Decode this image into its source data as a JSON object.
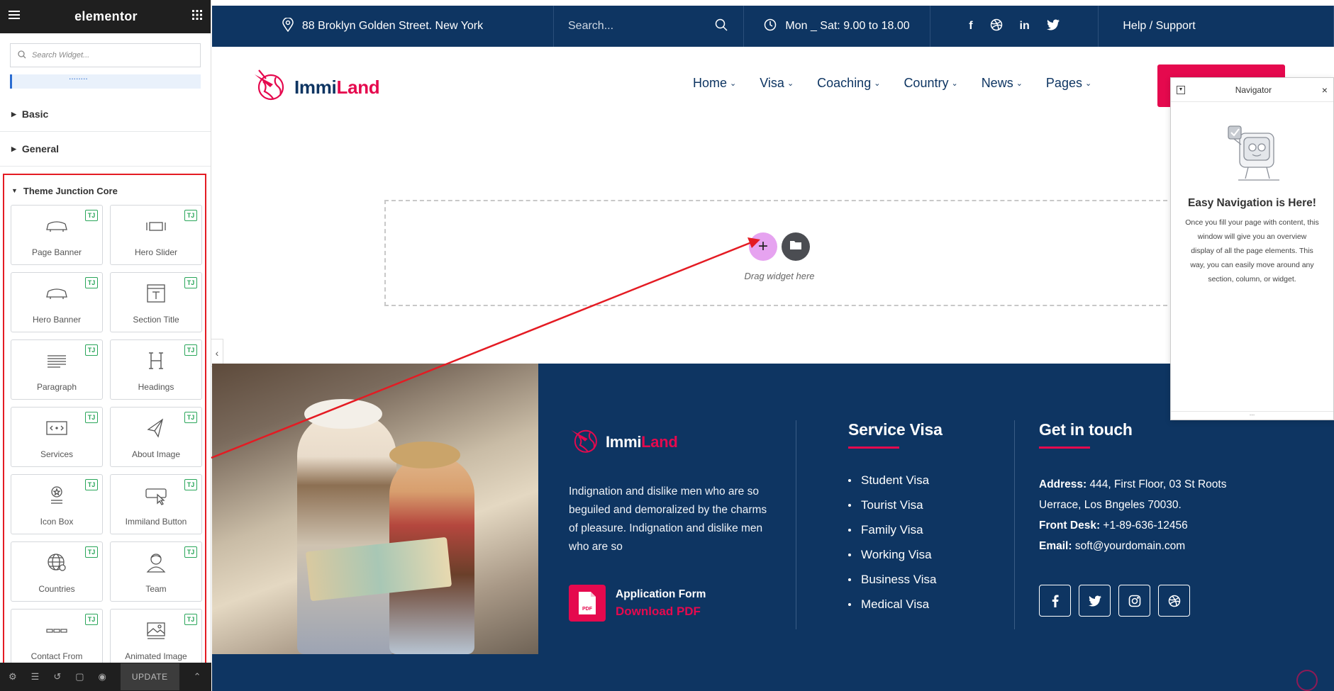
{
  "panel": {
    "logo": "elementor",
    "search_placeholder": "Search Widget...",
    "categories": [
      {
        "label": "Basic"
      },
      {
        "label": "General"
      }
    ],
    "theme_category": "Theme Junction Core",
    "badge": "TJ",
    "widgets": [
      {
        "label": "Page Banner",
        "icon": "sofa-icon"
      },
      {
        "label": "Hero Slider",
        "icon": "slider-icon"
      },
      {
        "label": "Hero Banner",
        "icon": "sofa-icon"
      },
      {
        "label": "Section Title",
        "icon": "text-icon"
      },
      {
        "label": "Paragraph",
        "icon": "paragraph-icon"
      },
      {
        "label": "Headings",
        "icon": "heading-icon"
      },
      {
        "label": "Services",
        "icon": "services-icon"
      },
      {
        "label": "About Image",
        "icon": "send-icon"
      },
      {
        "label": "Icon Box",
        "icon": "star-badge-icon"
      },
      {
        "label": "Immiland Button",
        "icon": "pointer-button-icon"
      },
      {
        "label": "Countries",
        "icon": "globe-icon"
      },
      {
        "label": "Team",
        "icon": "person-icon"
      },
      {
        "label": "Contact From",
        "icon": "form-icon"
      },
      {
        "label": "Animated Image",
        "icon": "image-icon"
      }
    ],
    "update_label": "UPDATE"
  },
  "topbar": {
    "address": "88 Broklyn Golden Street. New York",
    "search_placeholder": "Search...",
    "hours": "Mon _ Sat: 9.00 to 18.00",
    "help": "Help / Support"
  },
  "site": {
    "brand_part1": "Immi",
    "brand_part2": "Land",
    "nav": [
      "Home",
      "Visa",
      "Coaching",
      "Country",
      "News",
      "Pages"
    ]
  },
  "dropzone": {
    "text": "Drag widget here"
  },
  "footer": {
    "about": "Indignation and dislike men who are so beguiled and demoralized by the charms of pleasure. Indignation and dislike men who are so",
    "pdf_title": "Application Form",
    "pdf_link": "Download PDF",
    "pdf_badge": "PDF",
    "service_title": "Service Visa",
    "services": [
      "Student Visa",
      "Tourist Visa",
      "Family Visa",
      "Working Visa",
      "Business Visa",
      "Medical Visa"
    ],
    "contact_title": "Get in touch",
    "address_label": "Address:",
    "address_value": " 444, First Floor, 03 St Roots Uerrace, Los Bngeles 70030.",
    "desk_label": "Front Desk:",
    "desk_value": " +1-89-636-12456",
    "email_label": "Email:",
    "email_value": " soft@yourdomain.com"
  },
  "navigator": {
    "title": "Navigator",
    "heading": "Easy Navigation is Here!",
    "text": "Once you fill your page with content, this window will give you an overview display of all the page elements. This way, you can easily move around any section, column, or widget.",
    "footer": "..."
  },
  "colors": {
    "navy": "#0e3562",
    "accent": "#e5094e",
    "highlight": "#e41b23",
    "badge_green": "#2aa65a"
  }
}
